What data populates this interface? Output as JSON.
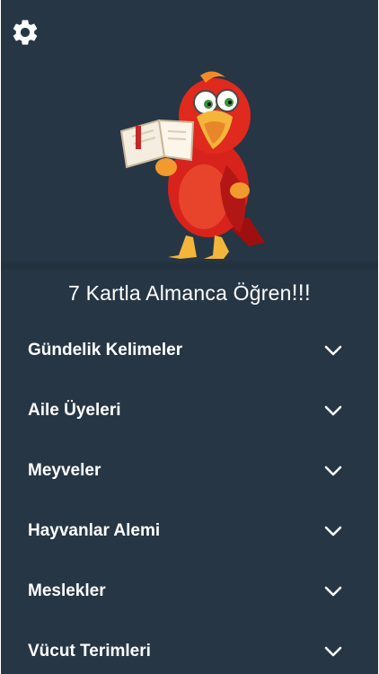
{
  "app": {
    "title_main": "7 Kartla Almanca Öğren",
    "title_exclaim": "!!!",
    "settings_icon": "gear-icon",
    "mascot": "parrot-reading-book-illustration"
  },
  "colors": {
    "background": "#263644",
    "text": "#ffffff",
    "parrot_red": "#d8231c"
  },
  "menu": {
    "items": [
      {
        "label": "Gündelik Kelimeler",
        "icon": "chevron-down-icon"
      },
      {
        "label": "Aile Üyeleri",
        "icon": "chevron-down-icon"
      },
      {
        "label": "Meyveler",
        "icon": "chevron-down-icon"
      },
      {
        "label": "Hayvanlar Alemi",
        "icon": "chevron-down-icon"
      },
      {
        "label": "Meslekler",
        "icon": "chevron-down-icon"
      },
      {
        "label": "Vücut Terimleri",
        "icon": "chevron-down-icon"
      }
    ]
  }
}
